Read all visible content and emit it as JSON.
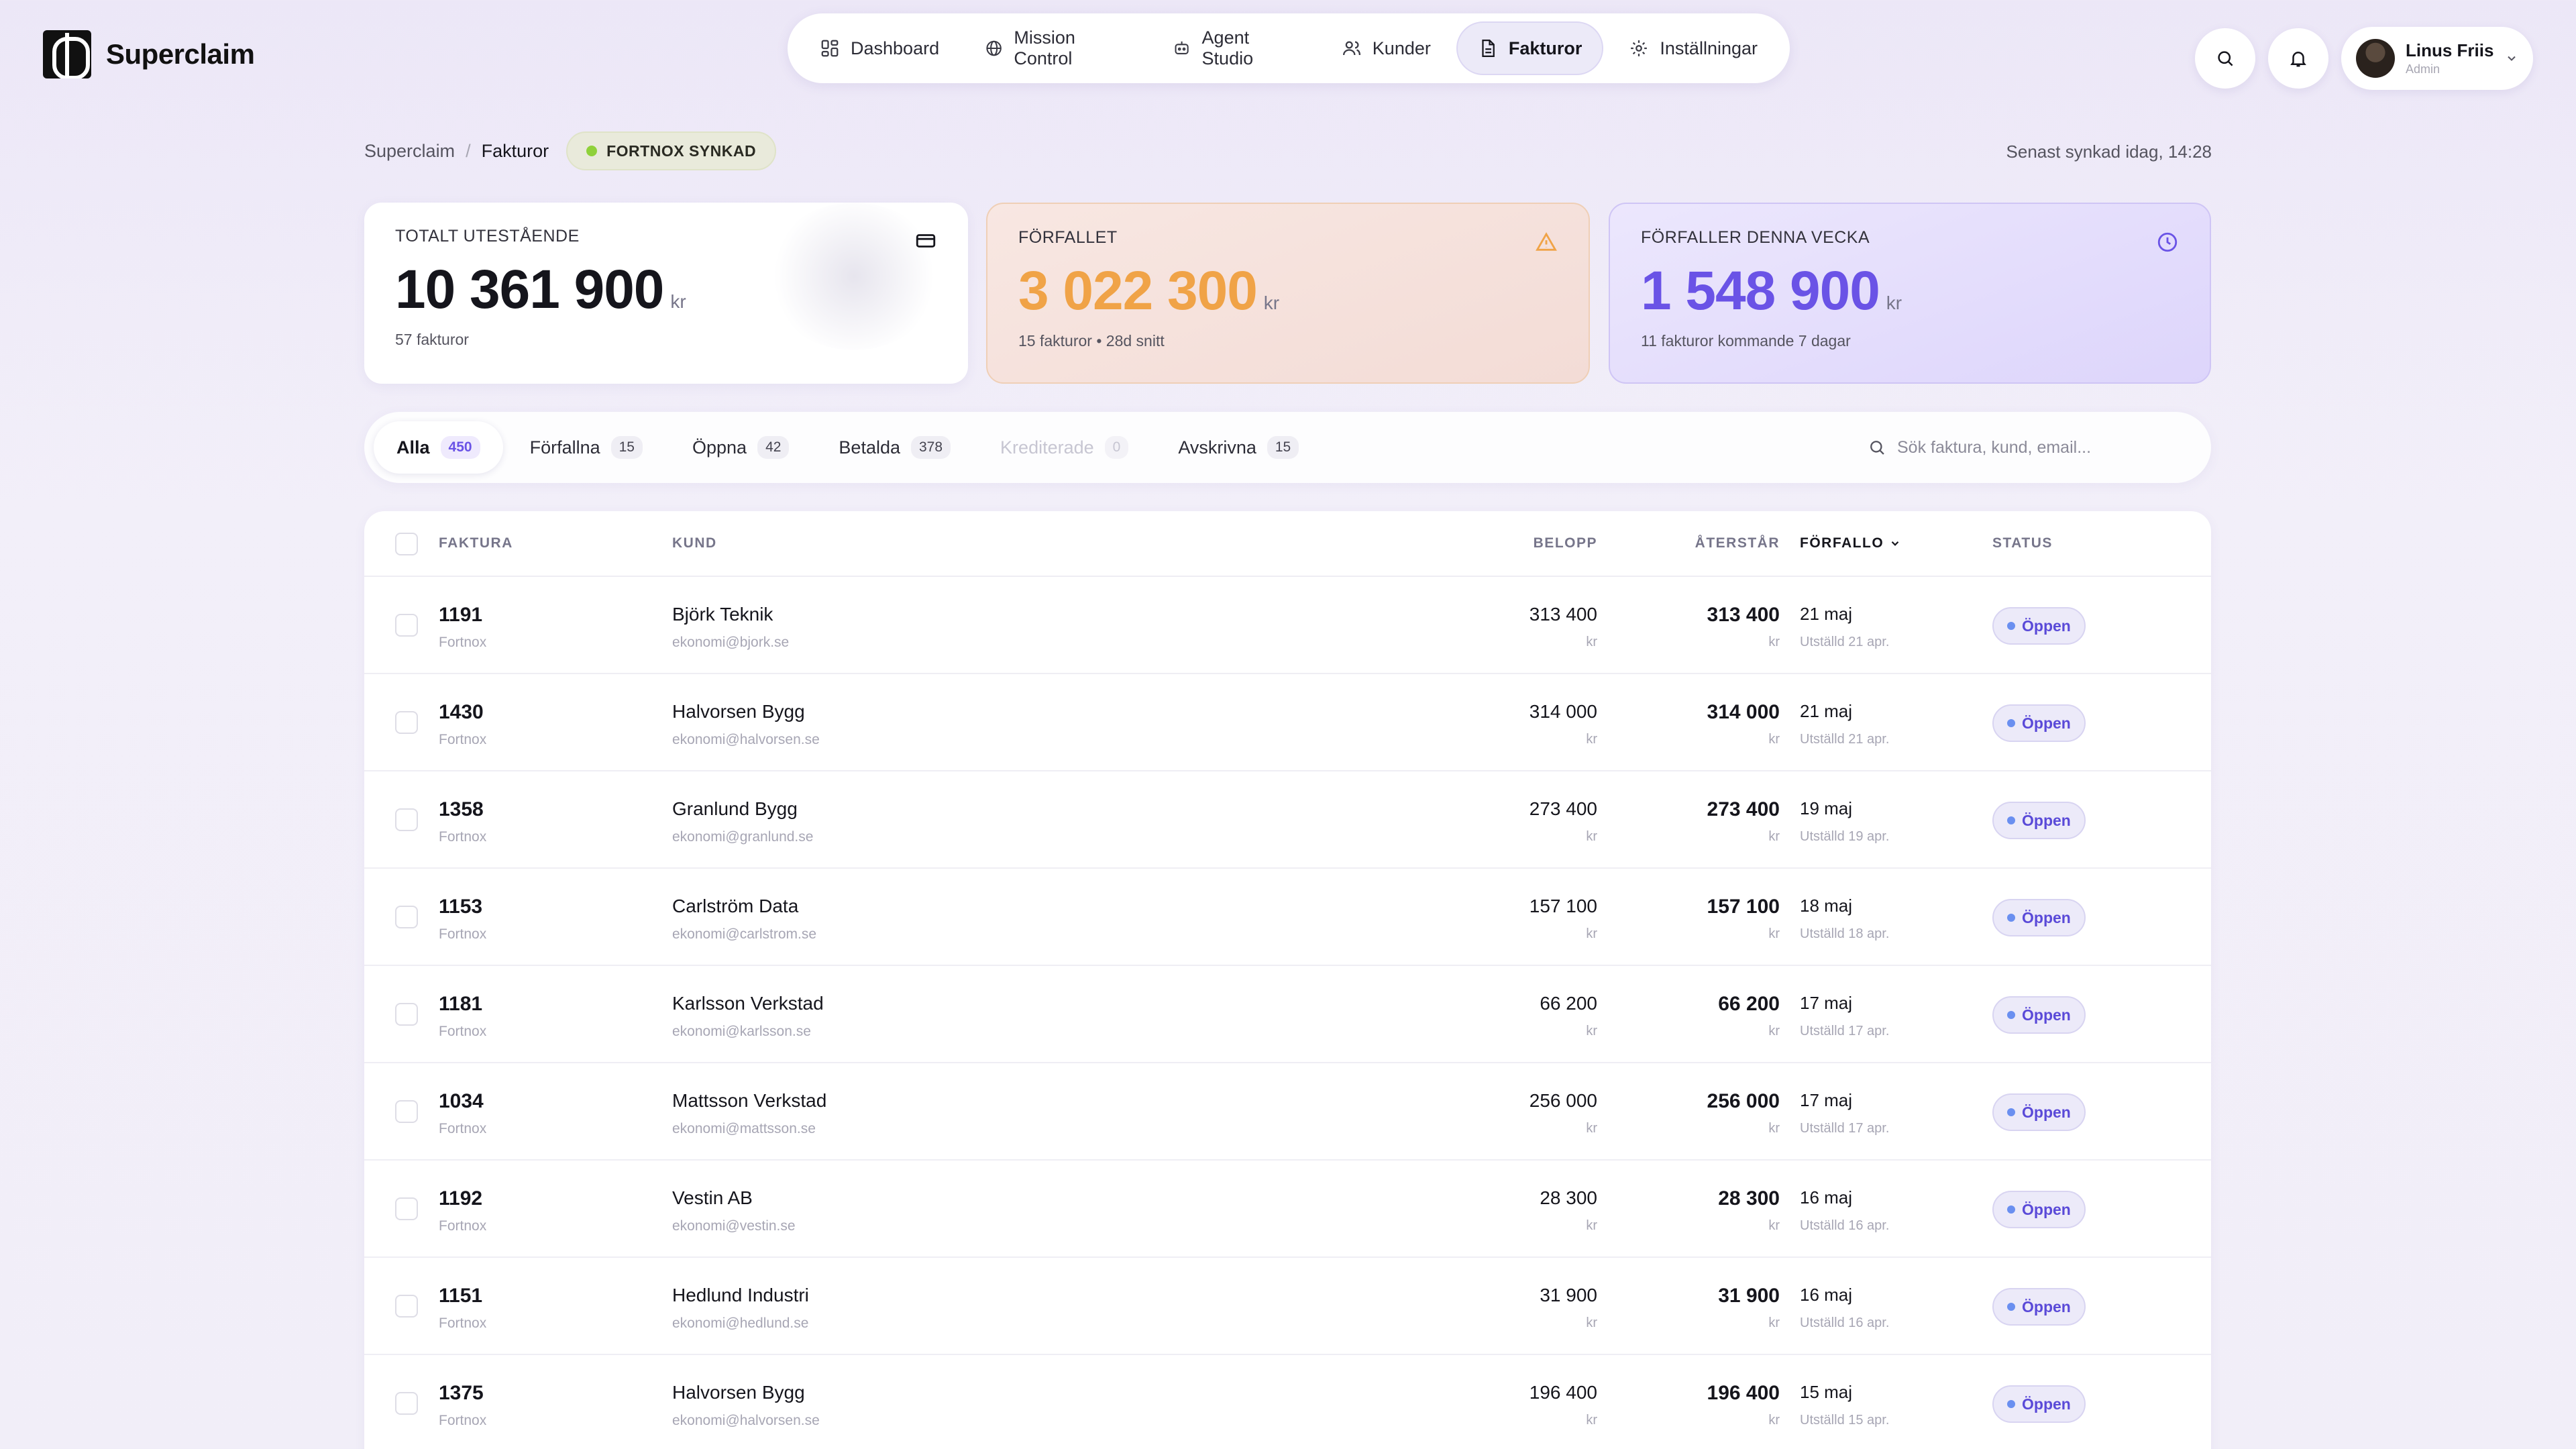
{
  "app": {
    "name": "Superclaim"
  },
  "nav": {
    "items": [
      {
        "label": "Dashboard",
        "icon": "grid-icon"
      },
      {
        "label": "Mission Control",
        "icon": "globe-icon"
      },
      {
        "label": "Agent Studio",
        "icon": "robot-icon"
      },
      {
        "label": "Kunder",
        "icon": "users-icon"
      },
      {
        "label": "Fakturor",
        "icon": "document-icon",
        "active": true
      },
      {
        "label": "Inställningar",
        "icon": "gear-icon"
      }
    ]
  },
  "user": {
    "name": "Linus Friis",
    "role": "Admin"
  },
  "breadcrumb": {
    "root": "Superclaim",
    "separator": "/",
    "current": "Fakturor",
    "sync_badge": "FORTNOX SYNKAD"
  },
  "last_sync": "Senast synkad idag, 14:28",
  "summary": {
    "total": {
      "title": "TOTALT UTESTÅENDE",
      "value": "10 361 900",
      "unit": "kr",
      "sub": "57 fakturor",
      "icon": "credit-card-icon"
    },
    "overdue": {
      "title": "FÖRFALLET",
      "value": "3 022 300",
      "unit": "kr",
      "sub": "15 fakturor • 28d snitt",
      "icon": "warning-icon",
      "color": "#f0a347"
    },
    "due_week": {
      "title": "FÖRFALLER DENNA VECKA",
      "value": "1 548 900",
      "unit": "kr",
      "sub": "11 fakturor kommande 7 dagar",
      "icon": "clock-icon",
      "color": "#6a53e6"
    }
  },
  "tabs": [
    {
      "label": "Alla",
      "count": "450",
      "active": true
    },
    {
      "label": "Förfallna",
      "count": "15"
    },
    {
      "label": "Öppna",
      "count": "42"
    },
    {
      "label": "Betalda",
      "count": "378"
    },
    {
      "label": "Krediterade",
      "count": "0",
      "disabled": true
    },
    {
      "label": "Avskrivna",
      "count": "15"
    }
  ],
  "search": {
    "placeholder": "Sök faktura, kund, email..."
  },
  "table": {
    "headers": {
      "invoice": "FAKTURA",
      "customer": "KUND",
      "amount": "BELOPP",
      "remaining": "ÅTERSTÅR",
      "due": "FÖRFALLO",
      "status": "STATUS"
    },
    "rows": [
      {
        "no": "1191",
        "source": "Fortnox",
        "customer": "Björk Teknik",
        "email": "ekonomi@bjork.se",
        "amount": "313 400",
        "remaining": "313 400",
        "unit": "kr",
        "due": "21 maj",
        "issued": "Utställd 21 apr.",
        "status": "Öppen"
      },
      {
        "no": "1430",
        "source": "Fortnox",
        "customer": "Halvorsen Bygg",
        "email": "ekonomi@halvorsen.se",
        "amount": "314 000",
        "remaining": "314 000",
        "unit": "kr",
        "due": "21 maj",
        "issued": "Utställd 21 apr.",
        "status": "Öppen"
      },
      {
        "no": "1358",
        "source": "Fortnox",
        "customer": "Granlund Bygg",
        "email": "ekonomi@granlund.se",
        "amount": "273 400",
        "remaining": "273 400",
        "unit": "kr",
        "due": "19 maj",
        "issued": "Utställd 19 apr.",
        "status": "Öppen"
      },
      {
        "no": "1153",
        "source": "Fortnox",
        "customer": "Carlström Data",
        "email": "ekonomi@carlstrom.se",
        "amount": "157 100",
        "remaining": "157 100",
        "unit": "kr",
        "due": "18 maj",
        "issued": "Utställd 18 apr.",
        "status": "Öppen"
      },
      {
        "no": "1181",
        "source": "Fortnox",
        "customer": "Karlsson Verkstad",
        "email": "ekonomi@karlsson.se",
        "amount": "66 200",
        "remaining": "66 200",
        "unit": "kr",
        "due": "17 maj",
        "issued": "Utställd 17 apr.",
        "status": "Öppen"
      },
      {
        "no": "1034",
        "source": "Fortnox",
        "customer": "Mattsson Verkstad",
        "email": "ekonomi@mattsson.se",
        "amount": "256 000",
        "remaining": "256 000",
        "unit": "kr",
        "due": "17 maj",
        "issued": "Utställd 17 apr.",
        "status": "Öppen"
      },
      {
        "no": "1192",
        "source": "Fortnox",
        "customer": "Vestin AB",
        "email": "ekonomi@vestin.se",
        "amount": "28 300",
        "remaining": "28 300",
        "unit": "kr",
        "due": "16 maj",
        "issued": "Utställd 16 apr.",
        "status": "Öppen"
      },
      {
        "no": "1151",
        "source": "Fortnox",
        "customer": "Hedlund Industri",
        "email": "ekonomi@hedlund.se",
        "amount": "31 900",
        "remaining": "31 900",
        "unit": "kr",
        "due": "16 maj",
        "issued": "Utställd 16 apr.",
        "status": "Öppen"
      },
      {
        "no": "1375",
        "source": "Fortnox",
        "customer": "Halvorsen Bygg",
        "email": "ekonomi@halvorsen.se",
        "amount": "196 400",
        "remaining": "196 400",
        "unit": "kr",
        "due": "15 maj",
        "issued": "Utställd 15 apr.",
        "status": "Öppen"
      }
    ]
  }
}
